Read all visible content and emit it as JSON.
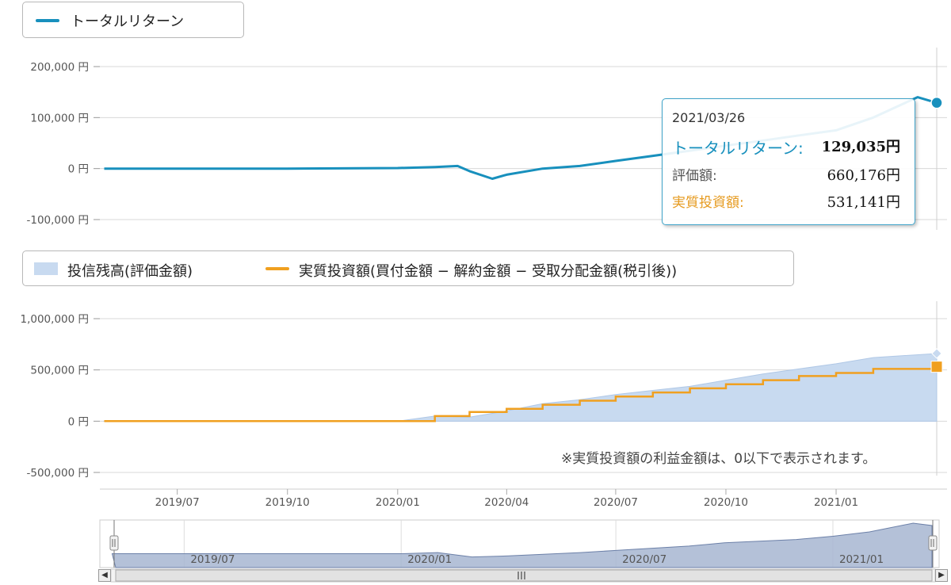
{
  "colors": {
    "total_return": "#1890bd",
    "invest_area": "#c8daf0",
    "invest_area_edge": "#b0c8e6",
    "actual_investment": "#f0a020",
    "navigator_area": "#a7b6d1",
    "navigator_line": "#6c80a8",
    "grid": "#d8d8d8",
    "tooltip_border": "#3ea3c9"
  },
  "legend_top": {
    "items": [
      {
        "label": "トータルリターン",
        "color": "#1890bd"
      }
    ]
  },
  "legend_bottom": {
    "items": [
      {
        "label": "投信残高(評価金額)",
        "color": "#c8daf0"
      },
      {
        "label": "実質投資額(買付金額 − 解約金額 − 受取分配金額(税引後))",
        "color": "#f0a020"
      }
    ]
  },
  "tooltip": {
    "date": "2021/03/26",
    "total_return_label": "トータルリターン:",
    "total_return_value": "129,035円",
    "valuation_label": "評価額:",
    "valuation_value": "660,176円",
    "investment_label": "実質投資額:",
    "investment_value": "531,141円"
  },
  "note": "※実質投資額の利益金額は、0以下で表示されます。",
  "navigator": {
    "scroll_label": "III",
    "left_arrow": "◀",
    "right_arrow": "▶",
    "handle": "||"
  },
  "chart_data": [
    {
      "type": "line",
      "title": "",
      "ylabel": "",
      "ylim": [
        -100000,
        200000
      ],
      "yticks": [
        "200,000 円",
        "100,000 円",
        "0 円",
        "-100,000 円"
      ],
      "ytick_values": [
        200000,
        100000,
        0,
        -100000
      ],
      "series": [
        {
          "name": "トータルリターン",
          "points": [
            [
              "2019-05",
              0
            ],
            [
              "2019-07",
              0
            ],
            [
              "2019-10",
              0
            ],
            [
              "2020-01",
              1000
            ],
            [
              "2020-02",
              3000
            ],
            [
              "2020-02-20",
              5000
            ],
            [
              "2020-03",
              -5000
            ],
            [
              "2020-03-20",
              -20000
            ],
            [
              "2020-04",
              -12000
            ],
            [
              "2020-05",
              0
            ],
            [
              "2020-06",
              5000
            ],
            [
              "2020-07",
              15000
            ],
            [
              "2020-08",
              25000
            ],
            [
              "2020-09",
              35000
            ],
            [
              "2020-10",
              45000
            ],
            [
              "2020-11",
              55000
            ],
            [
              "2020-12",
              65000
            ],
            [
              "2021-01",
              75000
            ],
            [
              "2021-02",
              100000
            ],
            [
              "2021-03-10",
              140000
            ],
            [
              "2021-03-26",
              129035
            ]
          ]
        }
      ]
    },
    {
      "type": "area",
      "title": "",
      "ylabel": "",
      "ylim": [
        -500000,
        1000000
      ],
      "yticks": [
        "1,000,000 円",
        "500,000 円",
        "0 円",
        "-500,000 円"
      ],
      "ytick_values": [
        1000000,
        500000,
        0,
        -500000
      ],
      "xticks": [
        "2019/07",
        "2019/10",
        "2020/01",
        "2020/04",
        "2020/07",
        "2020/10",
        "2021/01"
      ],
      "series": [
        {
          "name": "投信残高(評価金額)",
          "points": [
            [
              "2019-05",
              0
            ],
            [
              "2020-01",
              0
            ],
            [
              "2020-02",
              50000
            ],
            [
              "2020-03",
              40000
            ],
            [
              "2020-04",
              100000
            ],
            [
              "2020-05",
              170000
            ],
            [
              "2020-06",
              210000
            ],
            [
              "2020-07",
              260000
            ],
            [
              "2020-08",
              300000
            ],
            [
              "2020-09",
              340000
            ],
            [
              "2020-10",
              400000
            ],
            [
              "2020-11",
              460000
            ],
            [
              "2020-12",
              510000
            ],
            [
              "2021-01",
              560000
            ],
            [
              "2021-02",
              620000
            ],
            [
              "2021-03-26",
              660176
            ]
          ]
        },
        {
          "name": "実質投資額(買付金額 − 解約金額 − 受取分配金額(税引後))",
          "points": [
            [
              "2019-05",
              0
            ],
            [
              "2020-01",
              0
            ],
            [
              "2020-02",
              50000
            ],
            [
              "2020-03",
              90000
            ],
            [
              "2020-04",
              120000
            ],
            [
              "2020-05",
              160000
            ],
            [
              "2020-06",
              200000
            ],
            [
              "2020-07",
              240000
            ],
            [
              "2020-08",
              280000
            ],
            [
              "2020-09",
              320000
            ],
            [
              "2020-10",
              360000
            ],
            [
              "2020-11",
              400000
            ],
            [
              "2020-12",
              440000
            ],
            [
              "2021-01",
              470000
            ],
            [
              "2021-02",
              510000
            ],
            [
              "2021-03-26",
              531141
            ]
          ]
        }
      ]
    },
    {
      "type": "area",
      "title": "",
      "xticks": [
        "2019/07",
        "2020/01",
        "2020/07",
        "2021/01"
      ],
      "series": [
        {
          "name": "",
          "points": [
            [
              "2019-05",
              0
            ],
            [
              "2020-01",
              0
            ],
            [
              "2020-02",
              5000
            ],
            [
              "2020-03",
              -15000
            ],
            [
              "2020-04",
              -10000
            ],
            [
              "2020-06",
              5000
            ],
            [
              "2020-07",
              15000
            ],
            [
              "2020-09",
              35000
            ],
            [
              "2020-10",
              50000
            ],
            [
              "2020-12",
              65000
            ],
            [
              "2021-01",
              80000
            ],
            [
              "2021-02",
              100000
            ],
            [
              "2021-03-10",
              140000
            ],
            [
              "2021-03-26",
              129035
            ]
          ]
        }
      ]
    }
  ]
}
